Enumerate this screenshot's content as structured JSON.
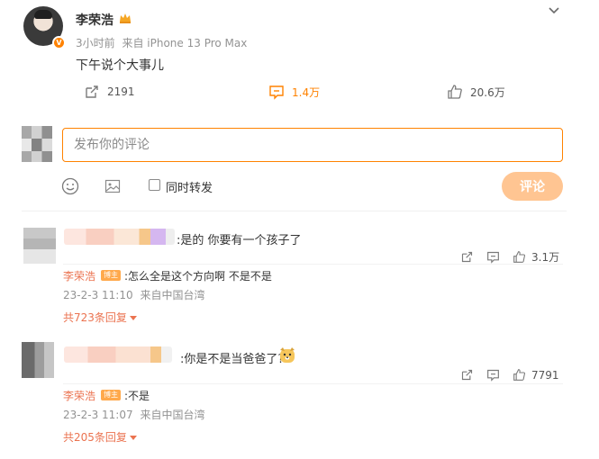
{
  "post": {
    "author": "李荣浩",
    "meta_time": "3小时前",
    "meta_source": "来自 iPhone 13 Pro Max",
    "text": "下午说个大事儿",
    "verified_badge": "V",
    "repost_count": "2191",
    "comment_count": "1.4万",
    "like_count": "20.6万"
  },
  "composer": {
    "placeholder": "发布你的评论",
    "repost_label": "同时转发",
    "submit_label": "评论"
  },
  "comments": [
    {
      "text": ":是的 你要有一个孩子了",
      "like_count": "3.1万",
      "reply": {
        "author": "李荣浩",
        "badge": "博主",
        "text": ":怎么全是这个方向啊 不是不是",
        "date": "23-2-3 11:10",
        "location": "来自中国台湾"
      },
      "reply_count": "共723条回复"
    },
    {
      "text": ":你是不是当爸爸了?",
      "like_count": "7791",
      "reply": {
        "author": "李荣浩",
        "badge": "博主",
        "text": ":不是",
        "date": "23-2-3 11:07",
        "location": "来自中国台湾"
      },
      "reply_count": "共205条回复"
    }
  ],
  "colors": {
    "accent": "#ff8200",
    "reply_name": "#eb7350",
    "submit_disabled": "#ffc592"
  }
}
